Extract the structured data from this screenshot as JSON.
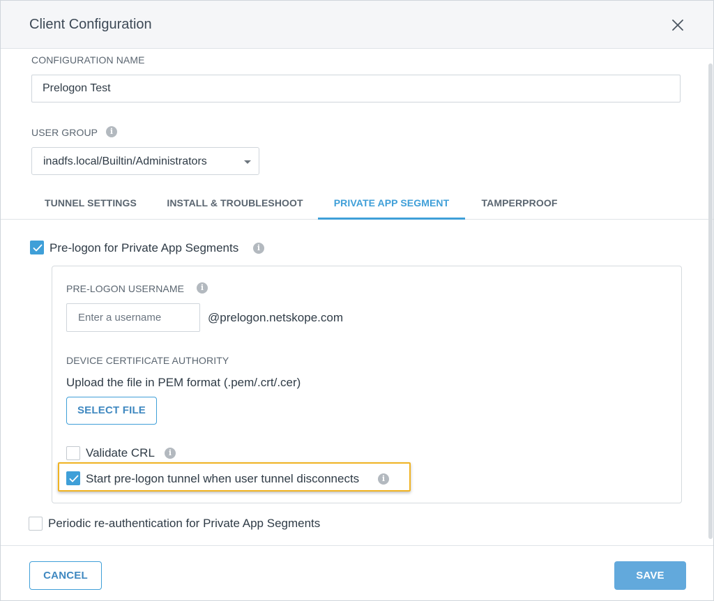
{
  "dialog": {
    "title": "Client Configuration"
  },
  "config_name": {
    "label": "CONFIGURATION NAME",
    "value": "Prelogon Test"
  },
  "user_group": {
    "label": "USER GROUP",
    "selected": "inadfs.local/Builtin/Administrators"
  },
  "tabs": [
    {
      "label": "TUNNEL SETTINGS",
      "active": false
    },
    {
      "label": "INSTALL & TROUBLESHOOT",
      "active": false
    },
    {
      "label": "PRIVATE APP SEGMENT",
      "active": true
    },
    {
      "label": "TAMPERPROOF",
      "active": false
    }
  ],
  "prelogon": {
    "label": "Pre-logon for Private App Segments",
    "checked": true,
    "username": {
      "label": "PRE-LOGON USERNAME",
      "placeholder": "Enter a username",
      "suffix": "@prelogon.netskope.com"
    },
    "device_ca": {
      "label": "DEVICE CERTIFICATE AUTHORITY",
      "hint": "Upload the file in PEM format (.pem/.crt/.cer)",
      "button": "SELECT FILE"
    },
    "validate_crl": {
      "label": "Validate CRL",
      "checked": false
    },
    "start_tunnel": {
      "label": "Start pre-logon tunnel when user tunnel disconnects",
      "checked": true
    }
  },
  "periodic_reauth": {
    "label": "Periodic re-authentication for Private App Segments",
    "checked": false
  },
  "footer": {
    "cancel": "CANCEL",
    "save": "SAVE"
  },
  "colors": {
    "accent": "#3f9fd8",
    "save_bg": "#62a9dc",
    "highlight": "#f0b323",
    "header_bg": "#f5f6f8"
  },
  "icons": {
    "close": "close-icon",
    "info": "info-icon",
    "caret": "caret-down-icon",
    "check": "check-icon"
  }
}
